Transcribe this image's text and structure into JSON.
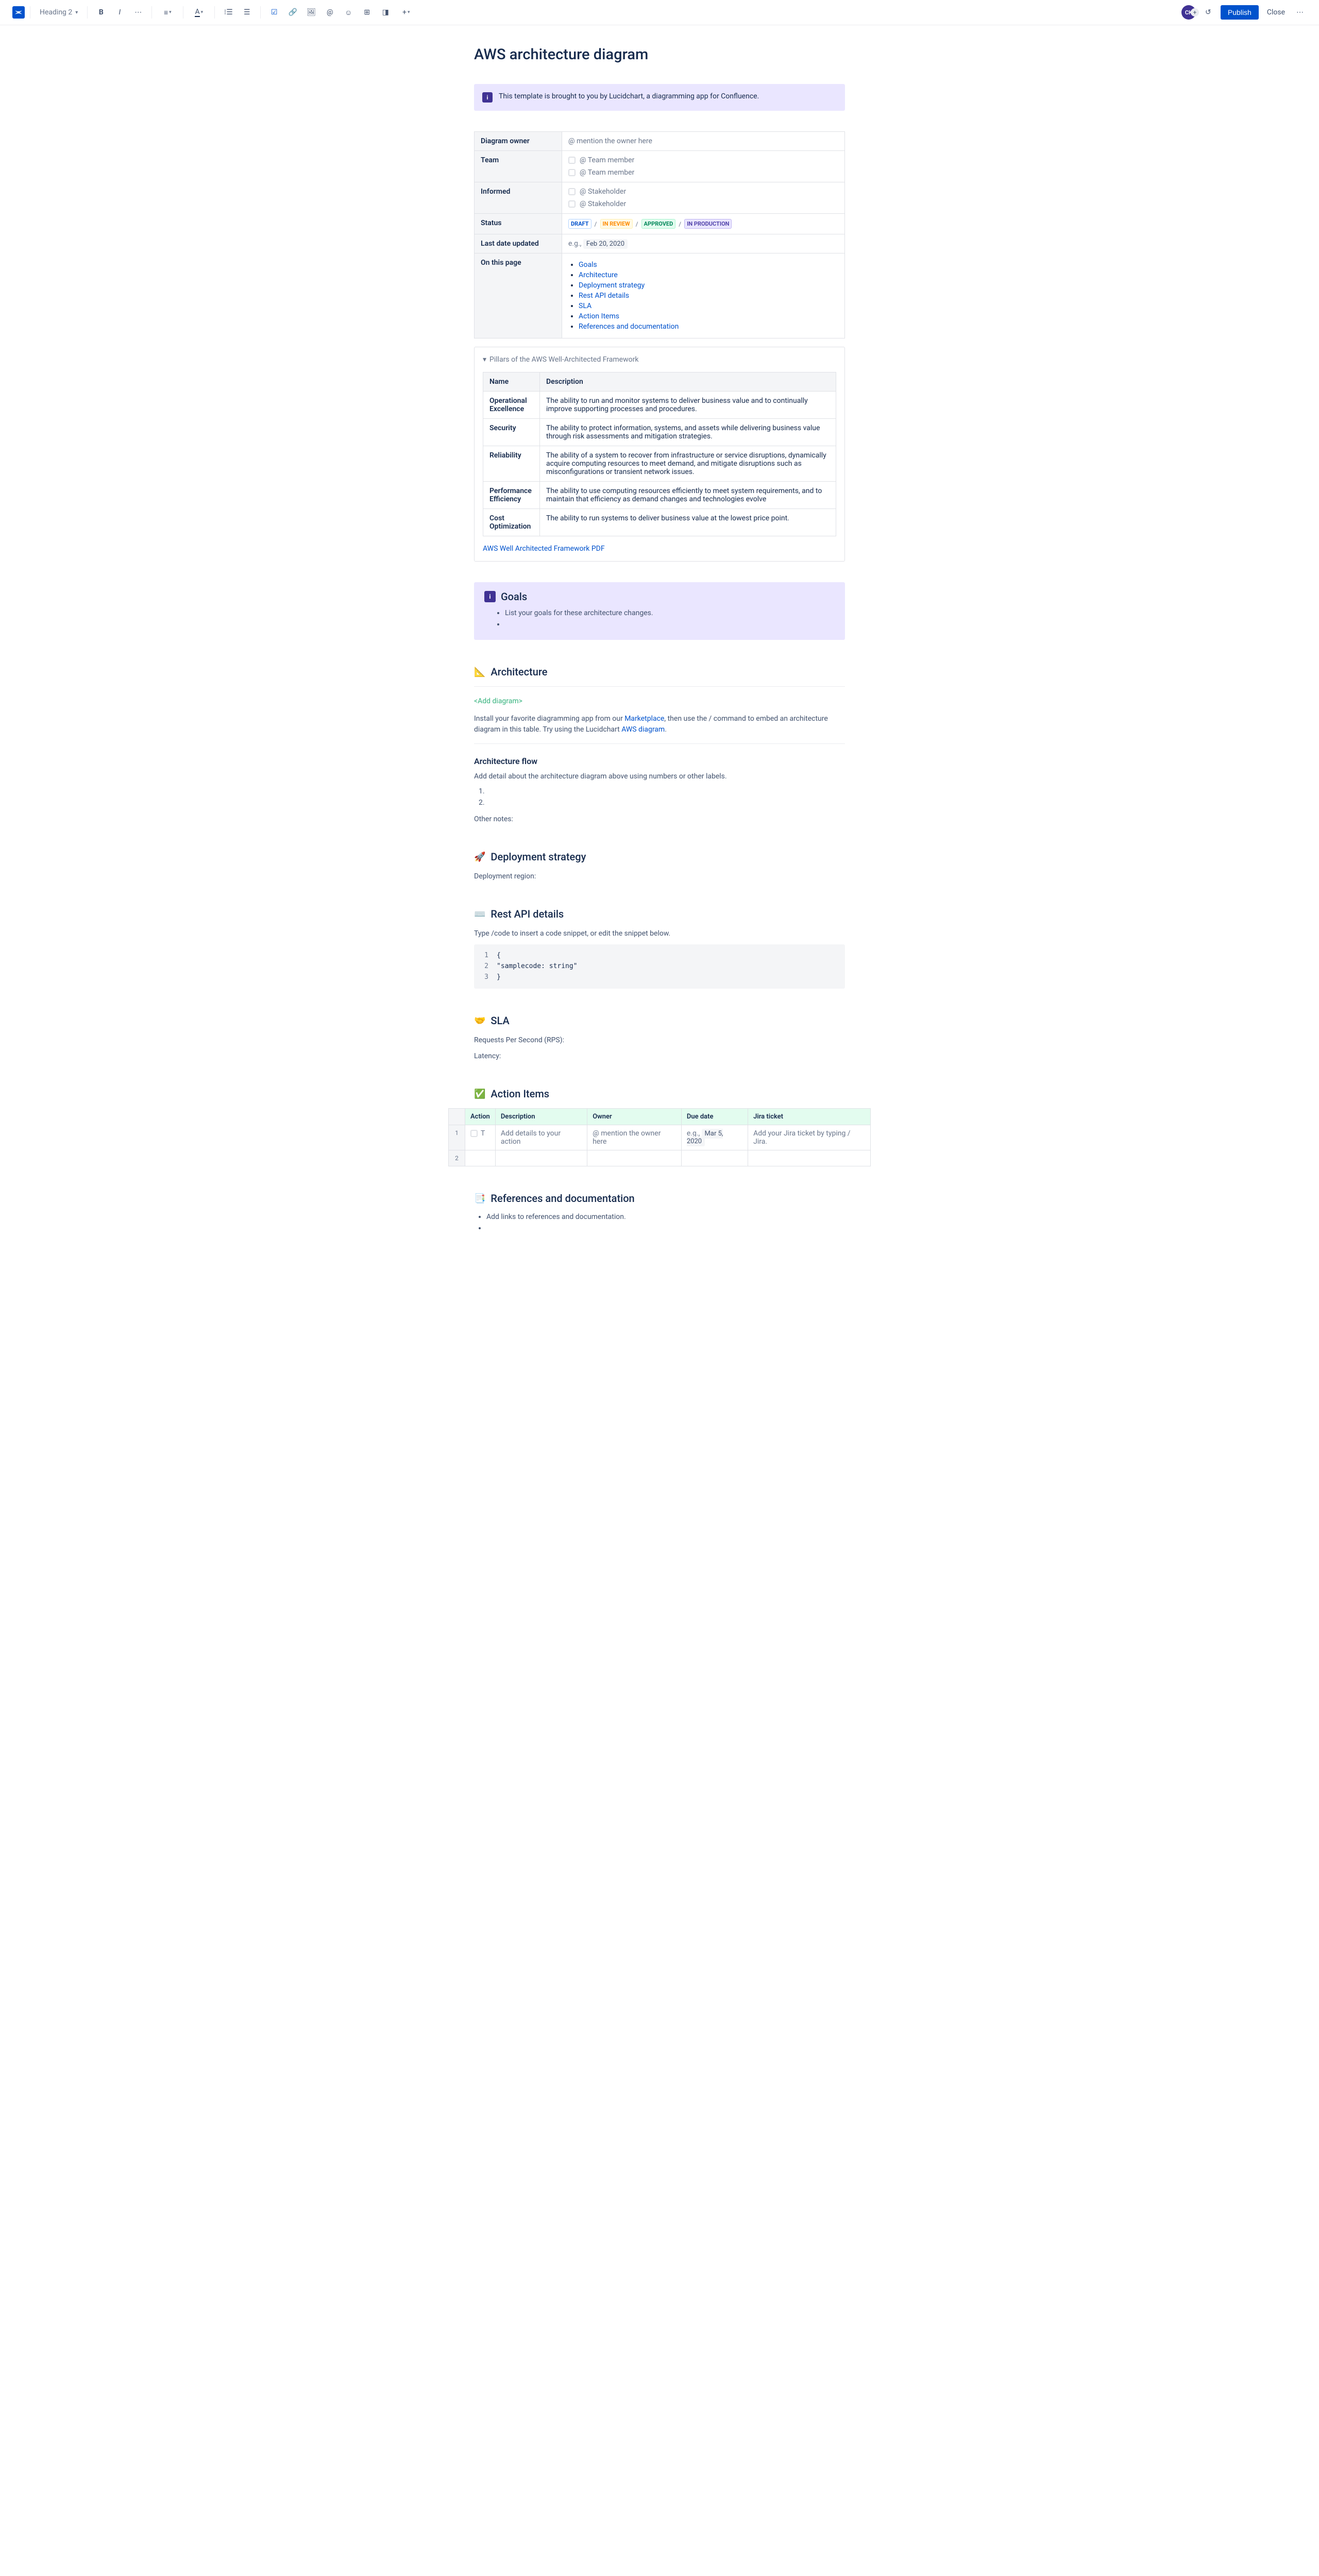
{
  "toolbar": {
    "heading_select": "Heading 2",
    "publish": "Publish",
    "close": "Close",
    "avatar_initials": "CK"
  },
  "page": {
    "title": "AWS architecture diagram"
  },
  "info_banner": "This template is brought to you by Lucidchart, a diagramming app for Confluence.",
  "meta": {
    "owner_label": "Diagram owner",
    "owner_placeholder": "@ mention the owner here",
    "team_label": "Team",
    "team_ph1": "@ Team member",
    "team_ph2": "@ Team member",
    "informed_label": "Informed",
    "informed_ph1": "@ Stakeholder",
    "informed_ph2": "@ Stakeholder",
    "status_label": "Status",
    "statuses": {
      "draft": "DRAFT",
      "review": "IN REVIEW",
      "approved": "APPROVED",
      "prod": "IN PRODUCTION"
    },
    "last_updated_label": "Last date updated",
    "last_updated_prefix": "e.g.,",
    "last_updated_date": "Feb 20, 2020",
    "on_page_label": "On this page",
    "toc": [
      "Goals",
      "Architecture",
      "Deployment strategy",
      "Rest API details",
      "SLA",
      "Action Items",
      "References and documentation"
    ]
  },
  "expand": {
    "title": "Pillars of the AWS Well-Architected Framework",
    "headers": {
      "name": "Name",
      "desc": "Description"
    },
    "rows": [
      {
        "name": "Operational Excellence",
        "desc": "The ability to run and monitor systems to deliver business value and to continually improve supporting processes and procedures."
      },
      {
        "name": "Security",
        "desc": "The ability to protect information, systems, and assets while delivering business value through risk assessments and mitigation strategies."
      },
      {
        "name": "Reliability",
        "desc": "The ability of a system to recover from infrastructure or service disruptions, dynamically acquire computing resources to meet demand, and mitigate disruptions such as misconfigurations or transient network issues."
      },
      {
        "name": "Performance Efficiency",
        "desc": "The ability to use computing resources efficiently to meet system requirements, and to maintain that efficiency as demand changes and technologies evolve"
      },
      {
        "name": "Cost Optimization",
        "desc": "The ability to run systems to deliver business value at the lowest price point."
      }
    ],
    "pdf_link": "AWS Well Architected Framework PDF"
  },
  "goals": {
    "heading": "Goals",
    "item1": "List your goals for these architecture changes."
  },
  "arch": {
    "heading": "Architecture",
    "add_diagram": "<Add diagram>",
    "p1_a": "Install your favorite diagramming app from our ",
    "p1_link1": "Marketplace",
    "p1_b": ", then use the / command to embed an architecture diagram in this table. Try using the Lucidchart ",
    "p1_link2": "AWS diagram",
    "p1_c": ".",
    "flow_heading": "Architecture flow",
    "flow_desc": "Add detail about the architecture diagram above using numbers or other labels.",
    "other_notes": "Other notes:"
  },
  "deploy": {
    "heading": "Deployment strategy",
    "region": "Deployment region:"
  },
  "rest": {
    "heading": "Rest API details",
    "desc": "Type /code to insert a code snippet, or edit the snippet below.",
    "code": {
      "l1": "{",
      "l2": "    \"samplecode: string\"",
      "l3": "}"
    }
  },
  "sla": {
    "heading": "SLA",
    "rps": "Requests Per Second (RPS):",
    "latency": "Latency:"
  },
  "actions": {
    "heading": "Action Items",
    "headers": {
      "action": "Action",
      "desc": "Description",
      "owner": "Owner",
      "due": "Due date",
      "jira": "Jira ticket"
    },
    "row1": {
      "action": "T",
      "desc": "Add details to your action",
      "owner": "@ mention the owner here",
      "due_prefix": "e.g.,",
      "due_date": "Mar 5, 2020",
      "jira": "Add your Jira ticket by typing / Jira."
    }
  },
  "refs": {
    "heading": "References and documentation",
    "item1": "Add links to references and documentation."
  }
}
